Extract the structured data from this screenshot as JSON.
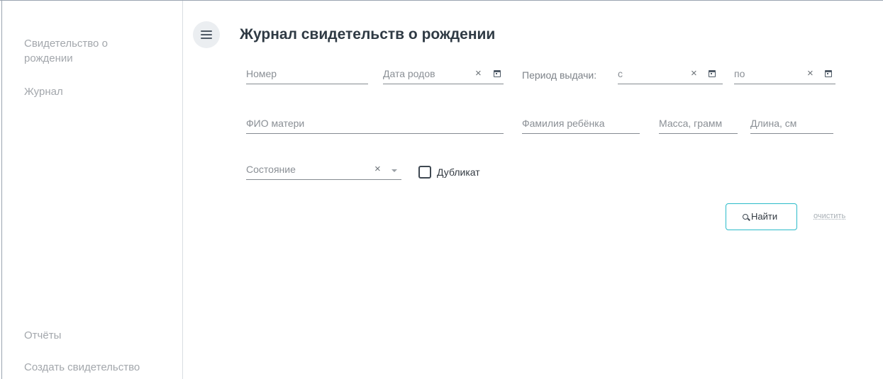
{
  "sidebar": {
    "items": [
      {
        "label": "Свидетельство о рождении"
      },
      {
        "label": "Журнал"
      },
      {
        "label": "Отчёты"
      },
      {
        "label": "Создать свидетельство"
      }
    ]
  },
  "header": {
    "menu_icon": "hamburger-menu-icon",
    "title": "Журнал свидетельств о рождении"
  },
  "filters": {
    "number": {
      "placeholder": "Номер",
      "value": ""
    },
    "birth_date": {
      "placeholder": "Дата родов",
      "value": ""
    },
    "issue_period": {
      "label": "Период выдачи:",
      "from": {
        "placeholder": "с",
        "value": ""
      },
      "to": {
        "placeholder": "по",
        "value": ""
      }
    },
    "mother_name": {
      "placeholder": "ФИО матери",
      "value": ""
    },
    "child_surname": {
      "placeholder": "Фамилия ребёнка",
      "value": ""
    },
    "weight": {
      "placeholder": "Масса, грамм",
      "value": ""
    },
    "length": {
      "placeholder": "Длина, см",
      "value": ""
    },
    "state": {
      "placeholder": "Состояние",
      "value": ""
    },
    "duplicate": {
      "label": "Дубликат",
      "checked": false
    }
  },
  "actions": {
    "find_label": "Найти",
    "find_icon": "search-icon",
    "clear_label": "очистить"
  },
  "icons": {
    "clear": "×",
    "calendar": "calendar-icon",
    "dropdown": "chevron-down-icon"
  },
  "colors": {
    "accent": "#2bbbc9",
    "sidebar_text": "#a3a7ac",
    "title": "#2f3a44"
  }
}
